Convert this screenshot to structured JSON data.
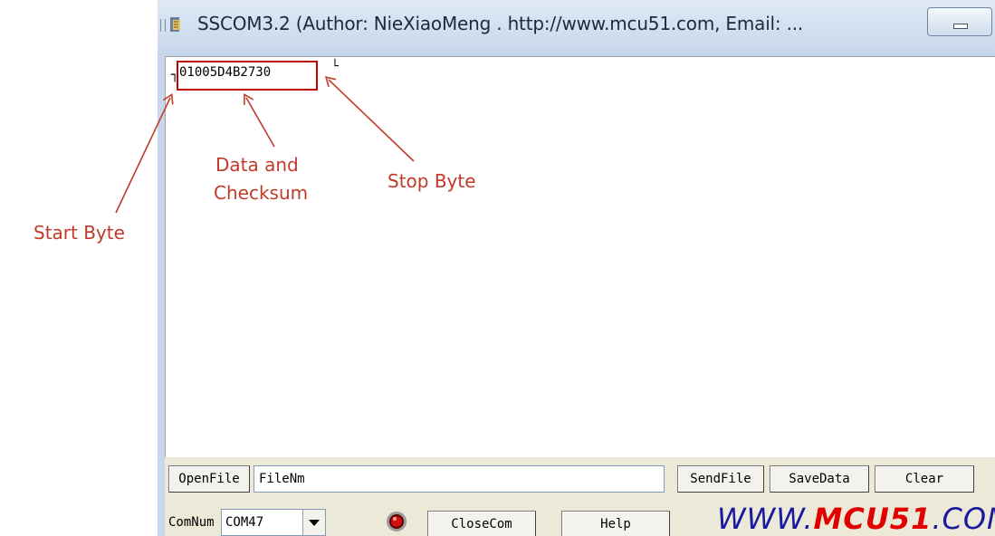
{
  "window": {
    "title": "SSCOM3.2 (Author: NieXiaoMeng .  http://www.mcu51.com,  Email: ..."
  },
  "receive": {
    "start_char": "┐",
    "data_text": "01005D4B2730",
    "stop_char": "└"
  },
  "annotations": {
    "start_byte": "Start Byte",
    "data_line1": "Data and",
    "data_line2": "Checksum",
    "stop_byte": "Stop Byte"
  },
  "row1": {
    "open_file": "OpenFile",
    "file_name_value": "FileNm",
    "send_file": "SendFile",
    "save_data": "SaveData",
    "clear": "Clear"
  },
  "row2": {
    "com_num_label": "ComNum",
    "com_port_value": "COM47",
    "close_com": "CloseCom",
    "help": "Help",
    "logo_left": "WWW.",
    "logo_mid": "MCU51",
    "logo_right": ".COM"
  },
  "colors": {
    "annotation": "#c23a28",
    "logo_blue": "#1a1aa0",
    "logo_red": "#e00000"
  }
}
